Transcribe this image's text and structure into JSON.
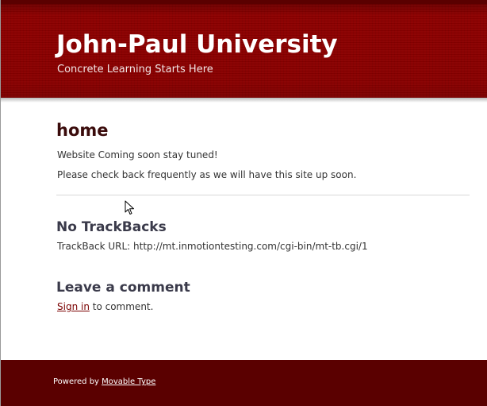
{
  "header": {
    "site_title": "John-Paul University",
    "tagline": "Concrete Learning Starts Here"
  },
  "entry": {
    "title": "home",
    "paragraphs": [
      "Website Coming soon stay tuned!",
      "Please check back frequently as we will have this site up soon."
    ]
  },
  "trackbacks": {
    "heading": "No TrackBacks",
    "url_label": "TrackBack URL: http://mt.inmotiontesting.com/cgi-bin/mt-tb.cgi/1"
  },
  "comments": {
    "heading": "Leave a comment",
    "signin_label": "Sign in",
    "signin_suffix": " to comment."
  },
  "footer": {
    "powered_prefix": "Powered by ",
    "powered_link": "Movable Type"
  },
  "colors": {
    "header_bg": "#8b0000",
    "footer_bg": "#5a0000",
    "link": "#7a0000"
  },
  "icons": {
    "cursor": "mouse-pointer-icon"
  }
}
